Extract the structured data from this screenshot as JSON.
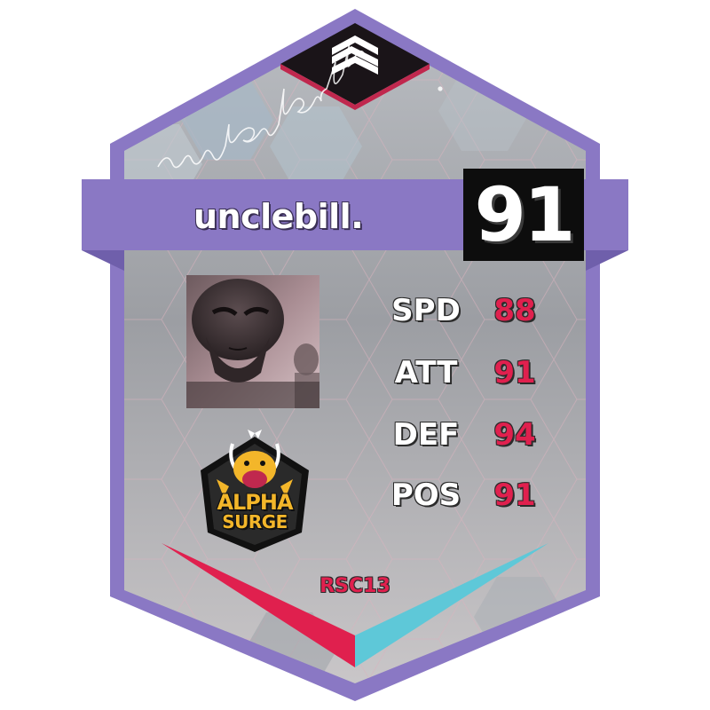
{
  "player": {
    "name": "unclebill.",
    "rating": "91",
    "signature": "unclebill."
  },
  "stats": [
    {
      "label": "SPD",
      "value": "88"
    },
    {
      "label": "ATT",
      "value": "91"
    },
    {
      "label": "DEF",
      "value": "94"
    },
    {
      "label": "POS",
      "value": "91"
    }
  ],
  "team": {
    "line1": "ALPHA",
    "line2": "SURGE"
  },
  "season": "RSC13",
  "icons": {
    "top_logo": "layered-stack-icon",
    "avatar": "alien-portrait",
    "team_logo": "dragon-crest-logo"
  },
  "colors": {
    "frame": "#8a78c4",
    "frame_dark": "#6f5fab",
    "rating_box": "#0d0d0d",
    "stat_value": "#e0204e",
    "chevron_left": "#e0204e",
    "chevron_right": "#5ec8d8",
    "team_gold": "#f3b62a"
  }
}
